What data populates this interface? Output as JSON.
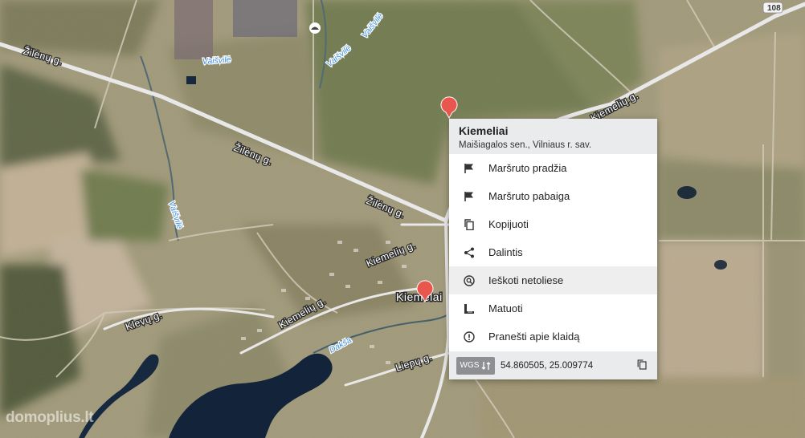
{
  "map": {
    "road_labels": [
      "Žilėnų g.",
      "Žilėnų g.",
      "Žilėnų g.",
      "Kiemelių g.",
      "Kiemelių g.",
      "Kiemelių g.",
      "Klevų g.",
      "Liepų g."
    ],
    "water_labels": [
      "Vaišvilė",
      "Vaišvilė",
      "Vaišvilė",
      "Vaišvilė",
      "Dakša"
    ],
    "village_label": "Kiemelai",
    "route_shield": "108",
    "colors": {
      "marker": "#e8564e",
      "road": "#e6e6e6",
      "water": "#12233a"
    }
  },
  "popup": {
    "title": "Kiemeliai",
    "subtitle": "Maišiagalos sen., Vilniaus r. sav.",
    "menu": [
      {
        "label": "Maršruto pradžia",
        "icon": "flag-icon"
      },
      {
        "label": "Maršruto pabaiga",
        "icon": "flag-icon"
      },
      {
        "label": "Kopijuoti",
        "icon": "copy-icon"
      },
      {
        "label": "Dalintis",
        "icon": "share-icon"
      },
      {
        "label": "Ieškoti netoliese",
        "icon": "search-nearby-icon"
      },
      {
        "label": "Matuoti",
        "icon": "ruler-icon"
      },
      {
        "label": "Pranešti apie klaidą",
        "icon": "alert-icon"
      }
    ],
    "footer": {
      "wgs_label": "WGS",
      "coordinates": "54.860505, 25.009774"
    }
  },
  "watermark": "domoplius.lt"
}
